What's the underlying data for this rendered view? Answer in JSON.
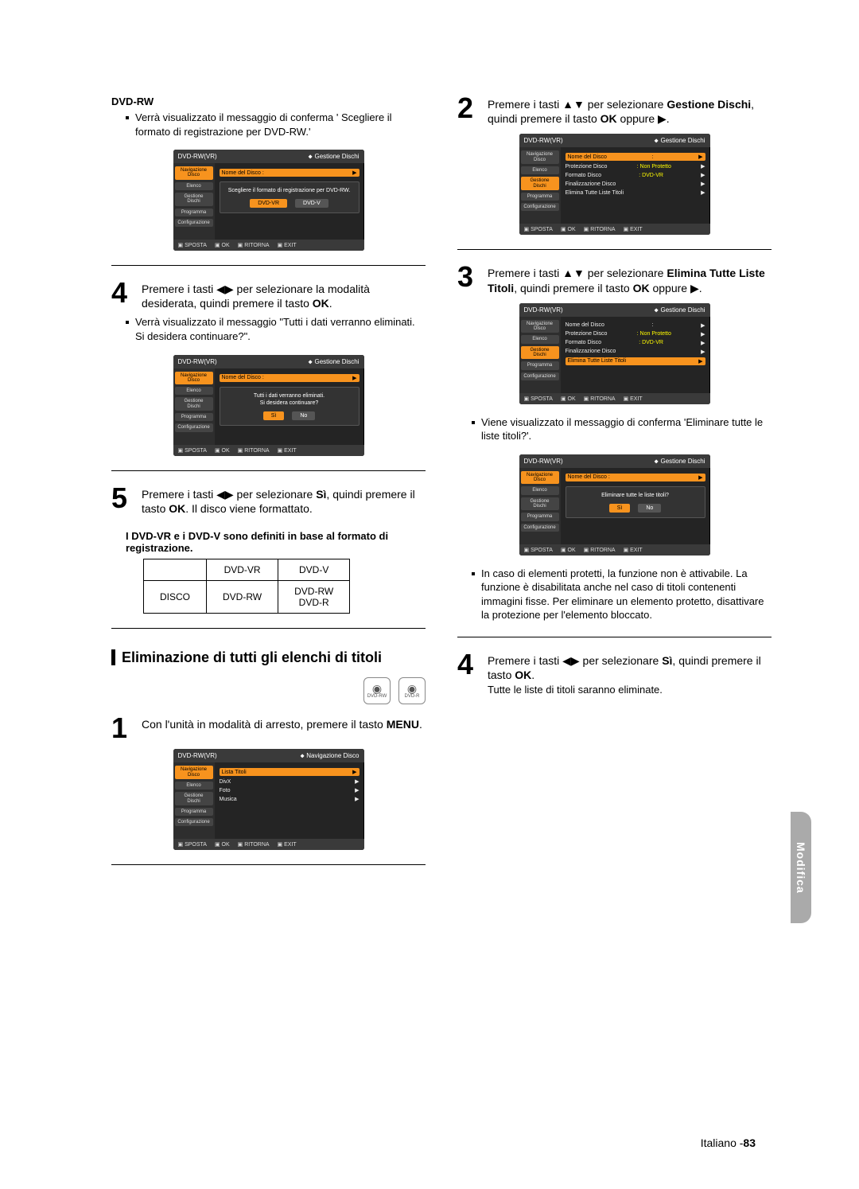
{
  "left": {
    "dvd_rw_head": "DVD-RW",
    "bullet_a": "Verrà visualizzato il messaggio di conferma ' Scegliere il formato di registrazione per DVD-RW.'",
    "panel_a": {
      "title_left": "DVD-RW(VR)",
      "title_right": "Gestione Dischi",
      "sidebar": [
        "Navigazione Disco",
        "Elenco",
        "Gestione Dischi",
        "Programma",
        "Configurazione"
      ],
      "row0": "Nome del Disco :",
      "dlg": "Scegliere il formato di registrazione per DVD-RW.",
      "btn_hl": "DVD-VR",
      "btn2": "DVD-V",
      "footer": [
        "SPOSTA",
        "OK",
        "RITORNA",
        "EXIT"
      ]
    },
    "step4": {
      "num": "4",
      "text": "Premere i tasti ◀▶ per selezionare la modalità desiderata, quindi premere il tasto ",
      "bold": "OK"
    },
    "bullet_b": "Verrà visualizzato il messaggio \"Tutti i dati verranno eliminati. Si desidera continuare?\".",
    "panel_b": {
      "title_left": "DVD-RW(VR)",
      "title_right": "Gestione Dischi",
      "sidebar": [
        "Navigazione Disco",
        "Elenco",
        "Gestione Dischi",
        "Programma",
        "Configurazione"
      ],
      "row0": "Nome del Disco :",
      "dlg_l1": "Tutti i dati verranno eliminati.",
      "dlg_l2": "Si desidera continuare?",
      "btn_hl": "Sì",
      "btn2": "No"
    },
    "step5": {
      "num": "5",
      "text_a": "Premere i tasti ◀▶ per selezionare ",
      "bold_a": "Sì",
      "text_b": ", quindi premere il tasto ",
      "bold_b": "OK",
      "text_c": ".  Il disco viene formattato."
    },
    "fmt_msg": "I DVD-VR e i DVD-V sono definiti in base al formato di registrazione.",
    "fmt_table": {
      "h1": "DVD-VR",
      "h2": "DVD-V",
      "r1c0": "DISCO",
      "r1c1": "DVD-RW",
      "r1c2a": "DVD-RW",
      "r1c2b": "DVD-R"
    },
    "section_title": "Eliminazione di tutti gli elenchi di titoli",
    "disc_labels": [
      "DVD-RW",
      "DVD-R"
    ],
    "step1": {
      "num": "1",
      "text_a": "Con l'unità in modalità di arresto, premere il tasto ",
      "bold": "MENU"
    },
    "panel_c": {
      "title_left": "DVD-RW(VR)",
      "title_right": "Navigazione Disco",
      "sidebar": [
        "Navigazione Disco",
        "Elenco",
        "Gestione Dischi",
        "Programma",
        "Configurazione"
      ],
      "rows": [
        "Lista Titoli",
        "DivX",
        "Foto",
        "Musica"
      ]
    }
  },
  "right": {
    "step2": {
      "num": "2",
      "text_a": "Premere i tasti ▲▼ per selezionare ",
      "bold_a": "Gestione Dischi",
      "text_b": ", quindi premere il tasto ",
      "bold_b": "OK",
      "text_c": " oppure ▶."
    },
    "panel_d": {
      "title_left": "DVD-RW(VR)",
      "title_right": "Gestione Dischi",
      "sidebar": [
        "Navigazione Disco",
        "Elenco",
        "Gestione Dischi",
        "Programma",
        "Configurazione"
      ],
      "rows": [
        {
          "k": "Nome del Disco",
          "v": ":"
        },
        {
          "k": "Protezione Disco",
          "v": ": Non Protetto"
        },
        {
          "k": "Formato Disco",
          "v": ": DVD-VR"
        },
        {
          "k": "Finalizzazione Disco",
          "v": ""
        },
        {
          "k": "Elimina Tutte Liste Titoli",
          "v": ""
        }
      ]
    },
    "step3": {
      "num": "3",
      "text_a": "Premere i tasti ▲▼ per selezionare ",
      "bold_a": "Elimina Tutte Liste Titoli",
      "text_b": ", quindi premere il tasto ",
      "bold_b": "OK",
      "text_c": " oppure ▶."
    },
    "panel_e_hl_row": "Elimina Tutte Liste Titoli",
    "bullet_c": "Viene visualizzato il messaggio di conferma 'Eliminare tutte le liste titoli?'.",
    "panel_f": {
      "row0": "Nome del Disco :",
      "dlg": "Eliminare tutte le liste titoli?",
      "btn_hl": "Sì",
      "btn2": "No"
    },
    "bullet_d": "In caso di elementi protetti, la funzione non è attivabile. La funzione è disabilitata anche nel caso di titoli contenenti immagini fisse. Per eliminare un elemento protetto, disattivare la protezione per l'elemento bloccato.",
    "step4": {
      "num": "4",
      "text_a": "Premere i tasti ◀▶ per selezionare ",
      "bold_a": "Sì",
      "text_b": ", quindi premere il tasto ",
      "bold_b": "OK",
      "note": "Tutte le liste di titoli saranno eliminate."
    }
  },
  "common": {
    "footer": [
      "SPOSTA",
      "OK",
      "RITORNA",
      "EXIT"
    ],
    "arrow": "▶"
  },
  "side_tab": "Modifica",
  "page_footer_lang": "Italiano -",
  "page_footer_num": "83"
}
